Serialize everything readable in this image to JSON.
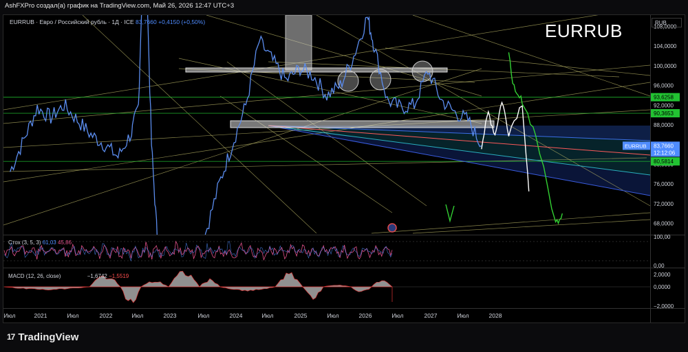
{
  "header": {
    "attribution": "AshFXPro создал(а) график на TradingView.com, Май 26, 2026 12:47 UTC+3"
  },
  "symbol": {
    "description": "EURRUB · Евро / Российский рубль · 1Д · ICE",
    "last": "83,7660",
    "change": "+0,4150 (+0,50%)",
    "big_ticker": "EURRUB",
    "currency": "RUB"
  },
  "price_axis": {
    "ticks": [
      "108,0000",
      "104,0000",
      "100,0000",
      "96,0000",
      "92,0000",
      "88,0000",
      "84,0000",
      "80,0000",
      "76,0000",
      "72,0000",
      "68,0000"
    ],
    "ylim": [
      65.7,
      110.3
    ]
  },
  "price_labels": [
    {
      "value": "93,6258",
      "color": "#22c232"
    },
    {
      "value": "90,3653",
      "color": "#22c232"
    },
    {
      "value": "80,5814",
      "color": "#22c232"
    }
  ],
  "last_price_label": {
    "symbol": "EURRUB",
    "value": "83,7660",
    "countdown": "12:12:06",
    "color": "#4f8cff"
  },
  "indicators": {
    "stoch": {
      "label": "Стох (3, 5, 3)",
      "v1": "61,03",
      "v2": "45,86",
      "axis_top": "100,00",
      "axis_bottom": "0,00",
      "color1": "#4f8cff",
      "color2": "#e0508a"
    },
    "macd": {
      "label": "MACD (12, 26, close)",
      "v1": "−1,6742",
      "v2": "−1,5519",
      "axis": [
        "2,0000",
        "0,0000",
        "−2,0000"
      ]
    }
  },
  "time_axis": [
    "Июл",
    "2021",
    "Июл",
    "2022",
    "Июл",
    "2023",
    "Июл",
    "2024",
    "Июл",
    "2025",
    "Июл",
    "2026",
    "Июл",
    "2027",
    "Июл",
    "2028"
  ],
  "branding": {
    "name": "TradingView",
    "mark": "17"
  },
  "chart_data": {
    "type": "line",
    "title": "EURRUB",
    "series": [
      {
        "name": "EURRUB",
        "color": "#5b8def",
        "x": [
          "2020-07",
          "2020-09",
          "2020-11",
          "2021-01",
          "2021-03",
          "2021-05",
          "2021-07",
          "2021-09",
          "2021-11",
          "2022-01",
          "2022-02",
          "2022-03",
          "2022-04",
          "2022-05",
          "2022-06",
          "2022-08",
          "2022-10",
          "2022-12",
          "2023-02",
          "2023-04",
          "2023-06",
          "2023-08",
          "2023-10",
          "2023-12",
          "2024-02",
          "2024-04",
          "2024-06",
          "2024-08",
          "2024-10",
          "2024-12",
          "2025-01",
          "2025-03",
          "2025-05",
          "2025-07",
          "2025-09",
          "2025-11",
          "2026-01",
          "2026-03",
          "2026-05"
        ],
        "values": [
          78.5,
          85.0,
          91.5,
          89.5,
          92.0,
          89.0,
          86.0,
          84.0,
          81.5,
          86.5,
          92.0,
          131.0,
          84.0,
          62.0,
          58.0,
          61.0,
          60.0,
          66.0,
          76.0,
          84.0,
          92.0,
          105.0,
          101.0,
          97.0,
          99.5,
          98.0,
          94.0,
          96.0,
          102.0,
          110.0,
          104.0,
          93.0,
          91.5,
          92.0,
          99.0,
          93.0,
          90.5,
          89.0,
          83.766
        ]
      }
    ],
    "projections": [
      {
        "color": "#ffffff",
        "x": [
          "2026-05",
          "2026-06",
          "2026-07",
          "2026-08",
          "2026-09",
          "2026-11",
          "2026-12"
        ],
        "values": [
          83.8,
          90.5,
          86.0,
          93.0,
          86.5,
          92.5,
          74.5
        ]
      },
      {
        "color": "#33d133",
        "x": [
          "2026-09",
          "2026-10",
          "2026-11",
          "2027-01",
          "2027-04",
          "2027-05"
        ],
        "values": [
          102.0,
          94.0,
          93.0,
          86.0,
          68.0,
          70.0
        ]
      }
    ],
    "levels": [
      {
        "value": 93.6258,
        "color": "#22c232"
      },
      {
        "value": 90.3653,
        "color": "#22c232"
      },
      {
        "value": 80.5814,
        "color": "#22c232"
      }
    ],
    "ylim": [
      65.7,
      110.3
    ],
    "x_range": [
      "2020-06",
      "2028-06"
    ],
    "grid": false,
    "legend": "top-left"
  }
}
